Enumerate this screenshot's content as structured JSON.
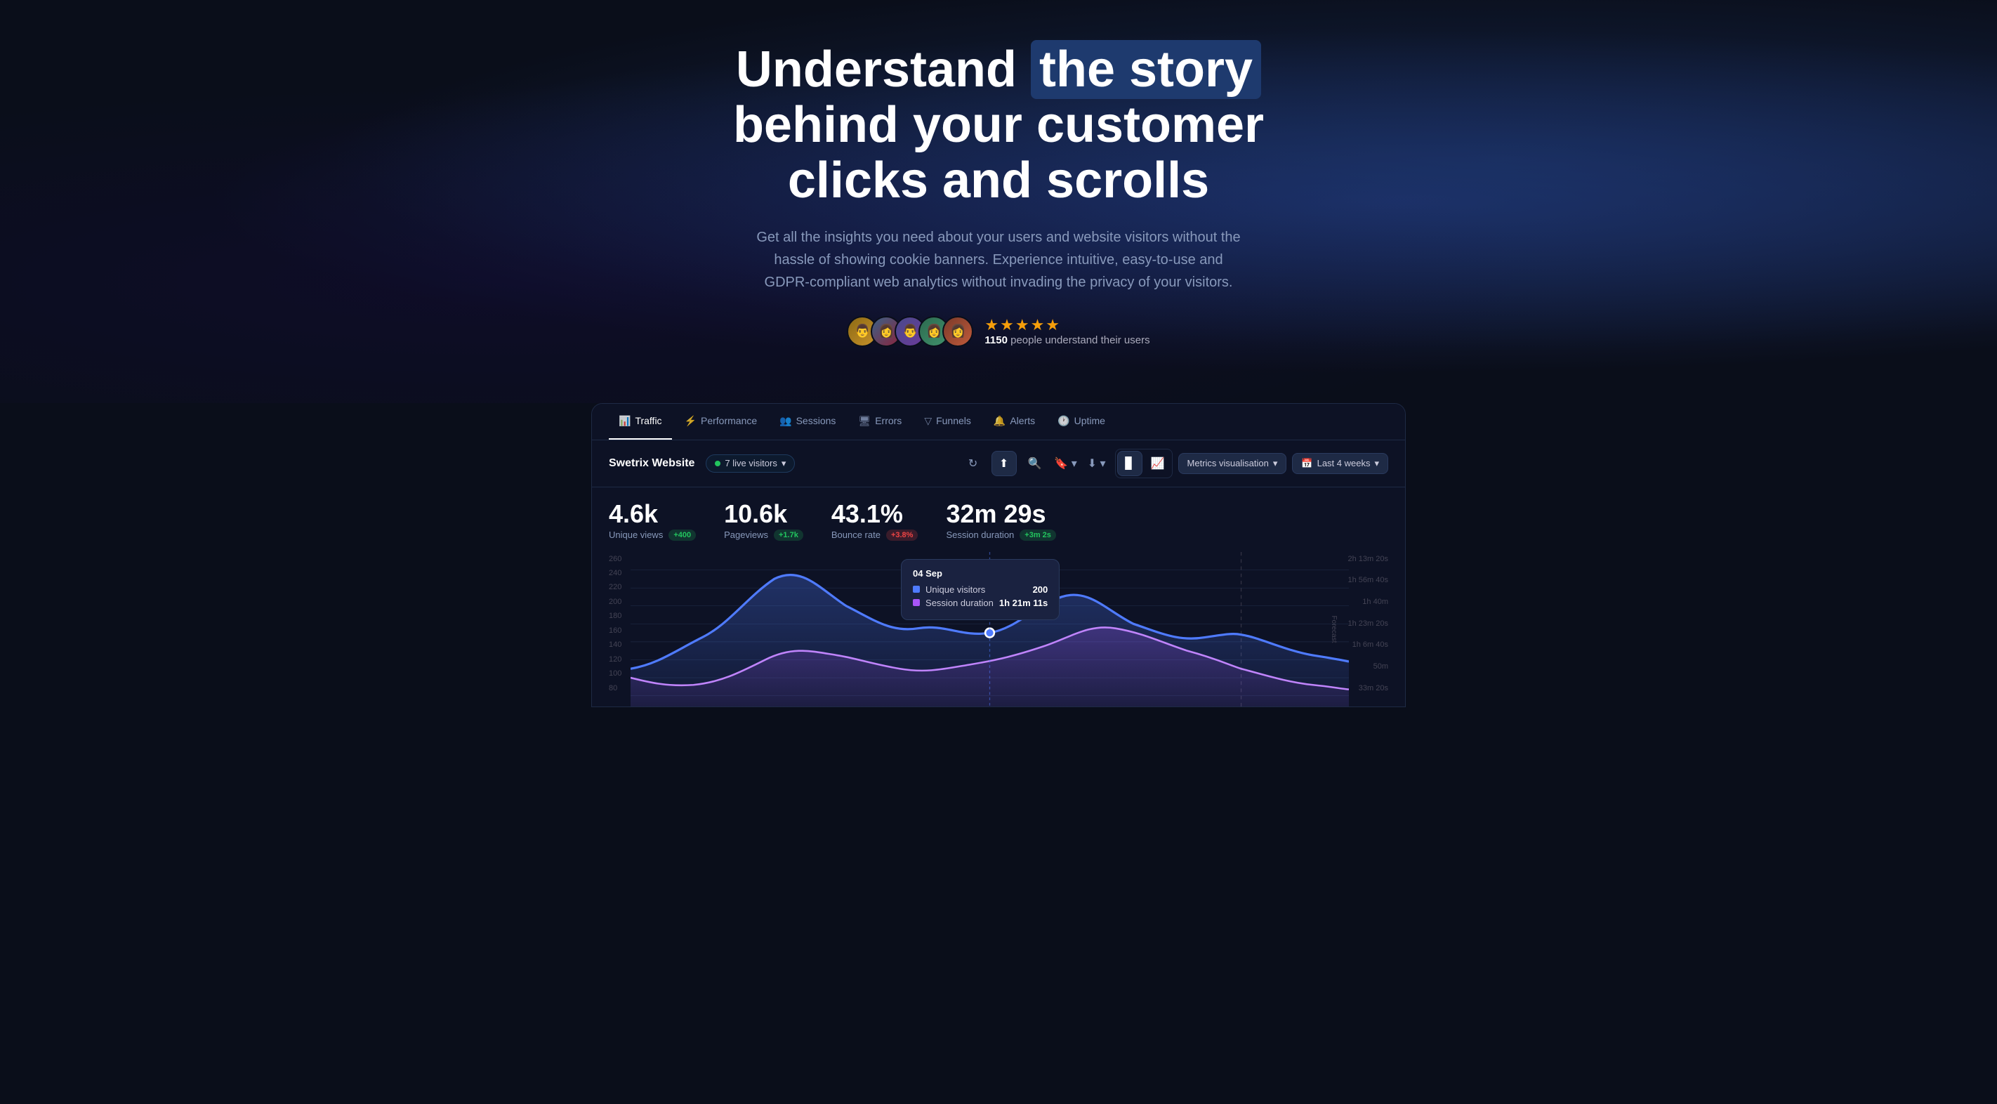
{
  "hero": {
    "title_part1": "Understand",
    "title_highlight": "the story",
    "title_part2": "behind your customer",
    "title_part3": "clicks and scrolls",
    "description": "Get all the insights you need about your users and website visitors without the hassle of showing cookie banners. Experience intuitive, easy-to-use and GDPR-compliant web analytics without invading the privacy of your visitors.",
    "stars": "★★★★★",
    "proof_count": "1150",
    "proof_text": "people understand their users"
  },
  "nav": {
    "tabs": [
      {
        "id": "traffic",
        "label": "Traffic",
        "icon": "📊",
        "active": true
      },
      {
        "id": "performance",
        "label": "Performance",
        "icon": "⚡",
        "active": false
      },
      {
        "id": "sessions",
        "label": "Sessions",
        "icon": "👥",
        "active": false
      },
      {
        "id": "errors",
        "label": "Errors",
        "icon": "🖥",
        "active": false
      },
      {
        "id": "funnels",
        "label": "Funnels",
        "icon": "⬦",
        "active": false
      },
      {
        "id": "alerts",
        "label": "Alerts",
        "icon": "🔔",
        "active": false
      },
      {
        "id": "uptime",
        "label": "Uptime",
        "icon": "🕐",
        "active": false
      }
    ]
  },
  "toolbar": {
    "site_name": "Swetrix Website",
    "live_visitors": "7 live visitors",
    "metrics_dropdown": "Metrics visualisation",
    "date_range": "Last 4 weeks"
  },
  "stats": [
    {
      "value": "4.6k",
      "label": "Unique views",
      "badge": "+400",
      "badge_type": "green"
    },
    {
      "value": "10.6k",
      "label": "Pageviews",
      "badge": "+1.7k",
      "badge_type": "green"
    },
    {
      "value": "43.1%",
      "label": "Bounce rate",
      "badge": "+3.8%",
      "badge_type": "red"
    },
    {
      "value": "32m 29s",
      "label": "Session duration",
      "badge": "+3m 2s",
      "badge_type": "green"
    }
  ],
  "chart": {
    "y_labels": [
      "260",
      "240",
      "220",
      "200",
      "180",
      "160",
      "140",
      "120",
      "100",
      "80"
    ],
    "y_labels_right": [
      "2h 13m 20s",
      "1h 56m 40s",
      "1h 40m",
      "1h 23m 20s",
      "1h 6m 40s",
      "50m",
      "33m 20s"
    ],
    "forecast_label": "Forecast"
  },
  "tooltip": {
    "date": "04 Sep",
    "rows": [
      {
        "label": "Unique visitors",
        "value": "200",
        "color": "#4f7bff"
      },
      {
        "label": "Session duration",
        "value": "1h 21m 11s",
        "color": "#a855f7"
      }
    ]
  }
}
